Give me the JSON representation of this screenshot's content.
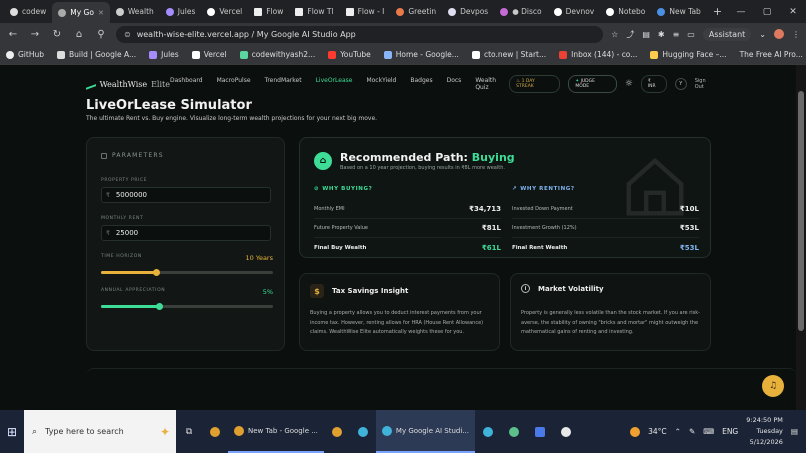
{
  "browser": {
    "tabs": [
      {
        "label": "codew",
        "active": false
      },
      {
        "label": "My Go",
        "active": true
      },
      {
        "label": "Wealth",
        "active": false
      },
      {
        "label": "Jules",
        "active": false
      },
      {
        "label": "Vercel",
        "active": false
      },
      {
        "label": "Flow",
        "active": false
      },
      {
        "label": "Flow Tl",
        "active": false
      },
      {
        "label": "Flow - I",
        "active": false
      },
      {
        "label": "Greetin",
        "active": false
      },
      {
        "label": "Devpos",
        "active": false
      },
      {
        "label": "● Disco",
        "active": false
      },
      {
        "label": "Devnov",
        "active": false
      },
      {
        "label": "Notebo",
        "active": false
      },
      {
        "label": "New Tab",
        "active": false
      }
    ],
    "url": "wealth-wise-elite.vercel.app / My Google AI Studio App",
    "assistant_label": "Assistant",
    "bookmarks": [
      "GitHub",
      "Build | Google A...",
      "Jules",
      "Vercel",
      "codewithyash2...",
      "YouTube",
      "Home - Google...",
      "cto.new | Start...",
      "Inbox (144) - co...",
      "Hugging Face –...",
      "The Free AI Pro..."
    ]
  },
  "app": {
    "logo_text": "WealthWise",
    "logo_suffix": "Elite",
    "nav": [
      "Dashboard",
      "MacroPulse",
      "TrendMarket",
      "LiveOrLease",
      "MockYield",
      "Badges",
      "Docs",
      "Wealth Quiz"
    ],
    "active_nav": "LiveOrLease",
    "streak": "1 DAY STREAK",
    "judge_mode": "JUDGE MODE",
    "currency": "₹ INR",
    "avatar": "Y",
    "sign_out": "Sign Out",
    "title": "LiveOrLease Simulator",
    "subtitle": "The ultimate Rent vs. Buy engine. Visualize long-term wealth projections for your next big move.",
    "parameters": {
      "heading": "PARAMETERS",
      "property_price_label": "PROPERTY PRICE",
      "property_price": "5000000",
      "monthly_rent_label": "MONTHLY RENT",
      "monthly_rent": "25000",
      "currency_symbol": "₹",
      "time_horizon_label": "TIME HORIZON",
      "time_horizon_value": "10 Years",
      "time_horizon_fraction": 0.32,
      "appreciation_label": "ANNUAL APPRECIATION",
      "appreciation_value": "5%",
      "appreciation_fraction": 0.34
    },
    "recommendation": {
      "title_prefix": "Recommended Path:",
      "path": "Buying",
      "subtitle": "Based on a 10 year projection, buying results in ₹8L more wealth.",
      "buy_heading": "WHY BUYING?",
      "buy_rows": [
        {
          "label": "Monthly EMI",
          "value": "₹34,713"
        },
        {
          "label": "Future Property Value",
          "value": "₹81L"
        }
      ],
      "buy_final_label": "Final Buy Wealth",
      "buy_final_value": "₹61L",
      "rent_heading": "WHY RENTING?",
      "rent_rows": [
        {
          "label": "Invested Down Payment",
          "value": "₹10L"
        },
        {
          "label": "Investment Growth (12%)",
          "value": "₹53L"
        }
      ],
      "rent_final_label": "Final Rent Wealth",
      "rent_final_value": "₹53L"
    },
    "tax": {
      "title": "Tax Savings Insight",
      "body": "Buying a property allows you to deduct interest payments from your income tax. However, renting allows for HRA (House Rent Allowance) claims. WealthWise Elite automatically weights these for you."
    },
    "volatility": {
      "title": "Market Volatility",
      "body": "Property is generally less volatile than the stock market. If you are risk-averse, the stability of owning \"bricks and mortar\" might outweigh the mathematical gains of renting and investing."
    }
  },
  "taskbar": {
    "search_placeholder": "Type here to search",
    "windows": [
      {
        "label": "New Tab - Google ...",
        "active": false
      },
      {
        "label": "My Google AI Studi...",
        "active": true
      }
    ],
    "temperature": "34°C",
    "lang": "ENG",
    "time": "9:24:50 PM",
    "day": "Tuesday",
    "date": "5/12/2026"
  },
  "colors": {
    "accent": "#3ddc97",
    "gold": "#e8b13c",
    "rent_blue": "#7fb4f0",
    "bg": "#0b0f0d"
  }
}
